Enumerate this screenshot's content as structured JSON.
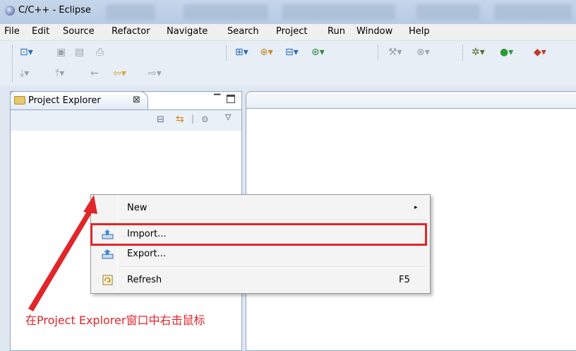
{
  "window": {
    "title": "C/C++ - Eclipse"
  },
  "menu": [
    "File",
    "Edit",
    "Source",
    "Refactor",
    "Navigate",
    "Search",
    "Project",
    "Run",
    "Window",
    "Help"
  ],
  "view": {
    "tab_label": "Project Explorer",
    "close_glyph": "⊠",
    "min_glyph": "▔"
  },
  "context_menu": {
    "items": [
      {
        "label": "New",
        "shortcut": "",
        "submenu": true,
        "icon": "none"
      },
      {
        "label": "Import...",
        "shortcut": "",
        "submenu": false,
        "icon": "import-icon"
      },
      {
        "label": "Export...",
        "shortcut": "",
        "submenu": false,
        "icon": "export-icon"
      },
      {
        "label": "Refresh",
        "shortcut": "F5",
        "submenu": false,
        "icon": "refresh-icon"
      }
    ],
    "submenu_glyph": "▸"
  },
  "annotation": {
    "text": "在Project Explorer窗口中右击鼠标",
    "color": "#e0262a"
  },
  "colors": {
    "highlight": "#e0262a",
    "panel_border": "#8fa7c4"
  }
}
